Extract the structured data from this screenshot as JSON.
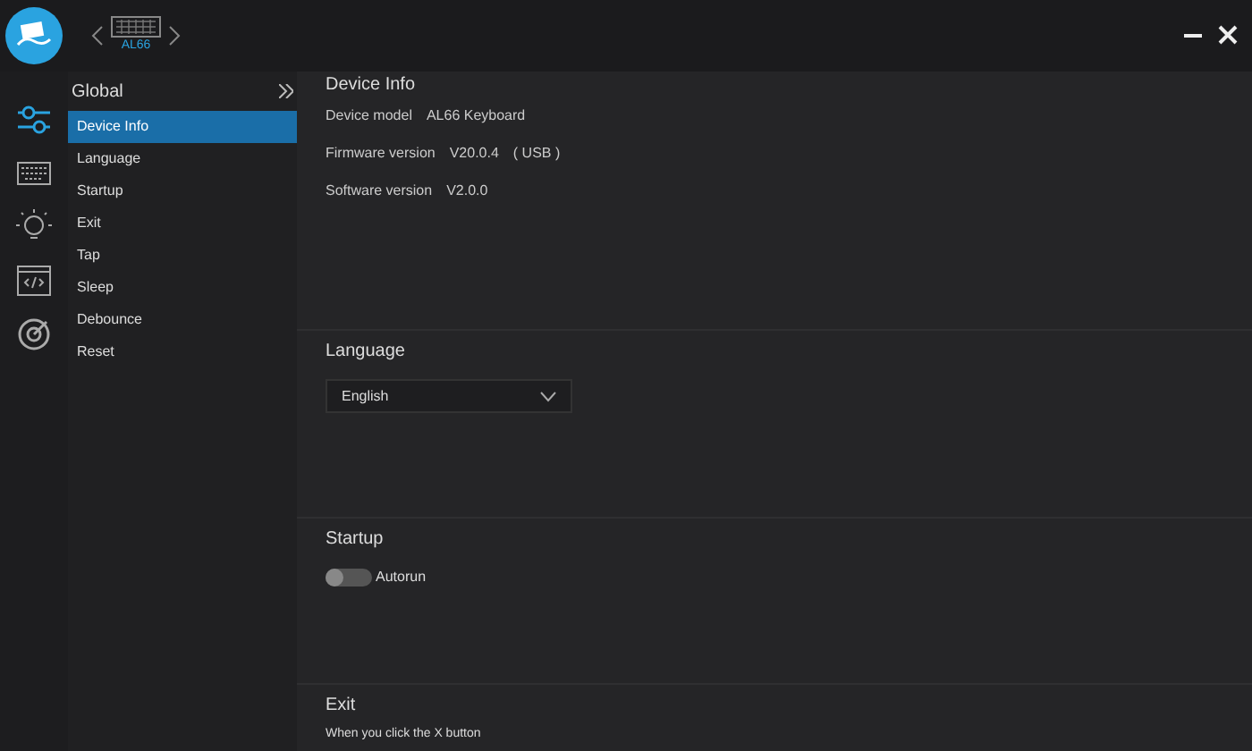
{
  "header": {
    "device_label": "AL66"
  },
  "rail": [
    {
      "kind": "sliders",
      "selected": true
    },
    {
      "kind": "keyboard",
      "selected": false
    },
    {
      "kind": "bulb",
      "selected": false
    },
    {
      "kind": "code",
      "selected": false
    },
    {
      "kind": "target",
      "selected": false
    }
  ],
  "sidebar": {
    "title": "Global",
    "items": [
      {
        "label": "Device Info",
        "selected": true
      },
      {
        "label": "Language",
        "selected": false
      },
      {
        "label": "Startup",
        "selected": false
      },
      {
        "label": "Exit",
        "selected": false
      },
      {
        "label": "Tap",
        "selected": false
      },
      {
        "label": "Sleep",
        "selected": false
      },
      {
        "label": "Debounce",
        "selected": false
      },
      {
        "label": "Reset",
        "selected": false
      }
    ]
  },
  "device_info": {
    "title": "Device Info",
    "rows": [
      {
        "label": "Device model",
        "value": "AL66 Keyboard"
      },
      {
        "label": "Firmware version",
        "value": "V20.0.4",
        "extra": "( USB )"
      },
      {
        "label": "Software version",
        "value": "V2.0.0"
      }
    ]
  },
  "language": {
    "title": "Language",
    "value": "English"
  },
  "startup": {
    "title": "Startup",
    "autorun": {
      "label": "Autorun",
      "on": false
    }
  },
  "exit": {
    "title": "Exit",
    "text": "When you click the X button"
  }
}
